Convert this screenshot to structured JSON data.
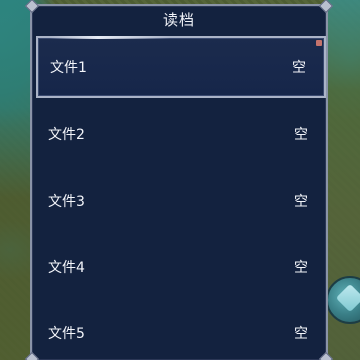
{
  "dialog": {
    "title": "读档",
    "slots": [
      {
        "name": "文件1",
        "status": "空",
        "selected": true
      },
      {
        "name": "文件2",
        "status": "空",
        "selected": false
      },
      {
        "name": "文件3",
        "status": "空",
        "selected": false
      },
      {
        "name": "文件4",
        "status": "空",
        "selected": false
      },
      {
        "name": "文件5",
        "status": "空",
        "selected": false
      }
    ]
  },
  "colors": {
    "panel_bg": "#13223f",
    "panel_border": "#8a94a8",
    "text": "#f3f5fa"
  },
  "icons": {
    "action_button": "attack-icon"
  }
}
